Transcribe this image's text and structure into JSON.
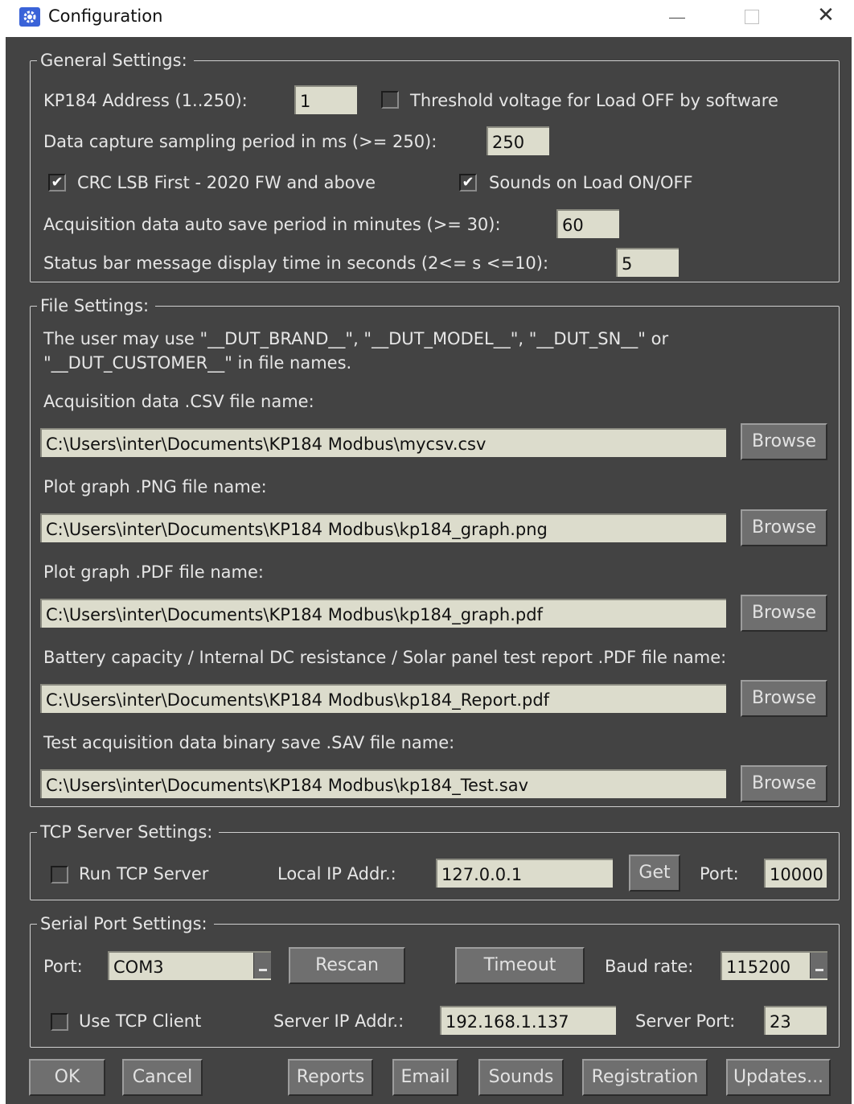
{
  "window": {
    "title": "Configuration"
  },
  "general": {
    "title": "General Settings:",
    "address_label": "KP184 Address (1..250):",
    "address_value": "1",
    "threshold_label": "Threshold voltage for Load OFF by software",
    "threshold_checked": false,
    "sampling_label": "Data capture sampling period in ms (>= 250):",
    "sampling_value": "250",
    "crc_label": "CRC LSB First - 2020 FW and above",
    "crc_checked": true,
    "sounds_label": "Sounds on Load ON/OFF",
    "sounds_checked": true,
    "autosave_label": "Acquisition data auto save period in minutes (>= 30):",
    "autosave_value": "60",
    "status_label": "Status bar message display time in seconds (2<= s <=10):",
    "status_value": "5"
  },
  "files": {
    "title": "File Settings:",
    "note_line1": "The user may use \"__DUT_BRAND__\", \"__DUT_MODEL__\", \"__DUT_SN__\" or",
    "note_line2": "\"__DUT_CUSTOMER__\" in file names.",
    "browse_label": "Browse",
    "csv_label": "Acquisition data .CSV file name:",
    "csv_value": "C:\\Users\\inter\\Documents\\KP184 Modbus\\mycsv.csv",
    "png_label": "Plot graph .PNG file name:",
    "png_value": "C:\\Users\\inter\\Documents\\KP184 Modbus\\kp184_graph.png",
    "pdf_label": "Plot graph .PDF file name:",
    "pdf_value": "C:\\Users\\inter\\Documents\\KP184 Modbus\\kp184_graph.pdf",
    "report_label": "Battery capacity / Internal DC resistance / Solar panel test report .PDF file name:",
    "report_value": "C:\\Users\\inter\\Documents\\KP184 Modbus\\kp184_Report.pdf",
    "sav_label": "Test acquisition data binary save .SAV file name:",
    "sav_value": "C:\\Users\\inter\\Documents\\KP184 Modbus\\kp184_Test.sav"
  },
  "tcp": {
    "title": "TCP Server Settings:",
    "run_label": "Run TCP Server",
    "run_checked": false,
    "ip_label": "Local IP Addr.:",
    "ip_value": "127.0.0.1",
    "get_label": "Get",
    "port_label": "Port:",
    "port_value": "10000"
  },
  "serial": {
    "title": "Serial Port Settings:",
    "port_label": "Port:",
    "port_value": "COM3",
    "rescan_label": "Rescan",
    "timeout_label": "Timeout",
    "baud_label": "Baud rate:",
    "baud_value": "115200",
    "client_label": "Use TCP Client",
    "client_checked": false,
    "server_ip_label": "Server IP Addr.:",
    "server_ip_value": "192.168.1.137",
    "server_port_label": "Server Port:",
    "server_port_value": "23"
  },
  "buttons": {
    "ok": "OK",
    "cancel": "Cancel",
    "reports": "Reports",
    "email": "Email",
    "sounds": "Sounds",
    "registration": "Registration",
    "updates": "Updates..."
  },
  "icons": {
    "app": "gear-icon",
    "minimize": "minimize-icon",
    "maximize": "maximize-icon",
    "close": "close-icon",
    "checkmark": "✔",
    "close_glyph": "✕"
  },
  "colors": {
    "dialog_bg": "#434343",
    "field_bg": "#dcdccc",
    "button_bg": "#6f6f6f",
    "app_icon": "#3a63d8"
  }
}
